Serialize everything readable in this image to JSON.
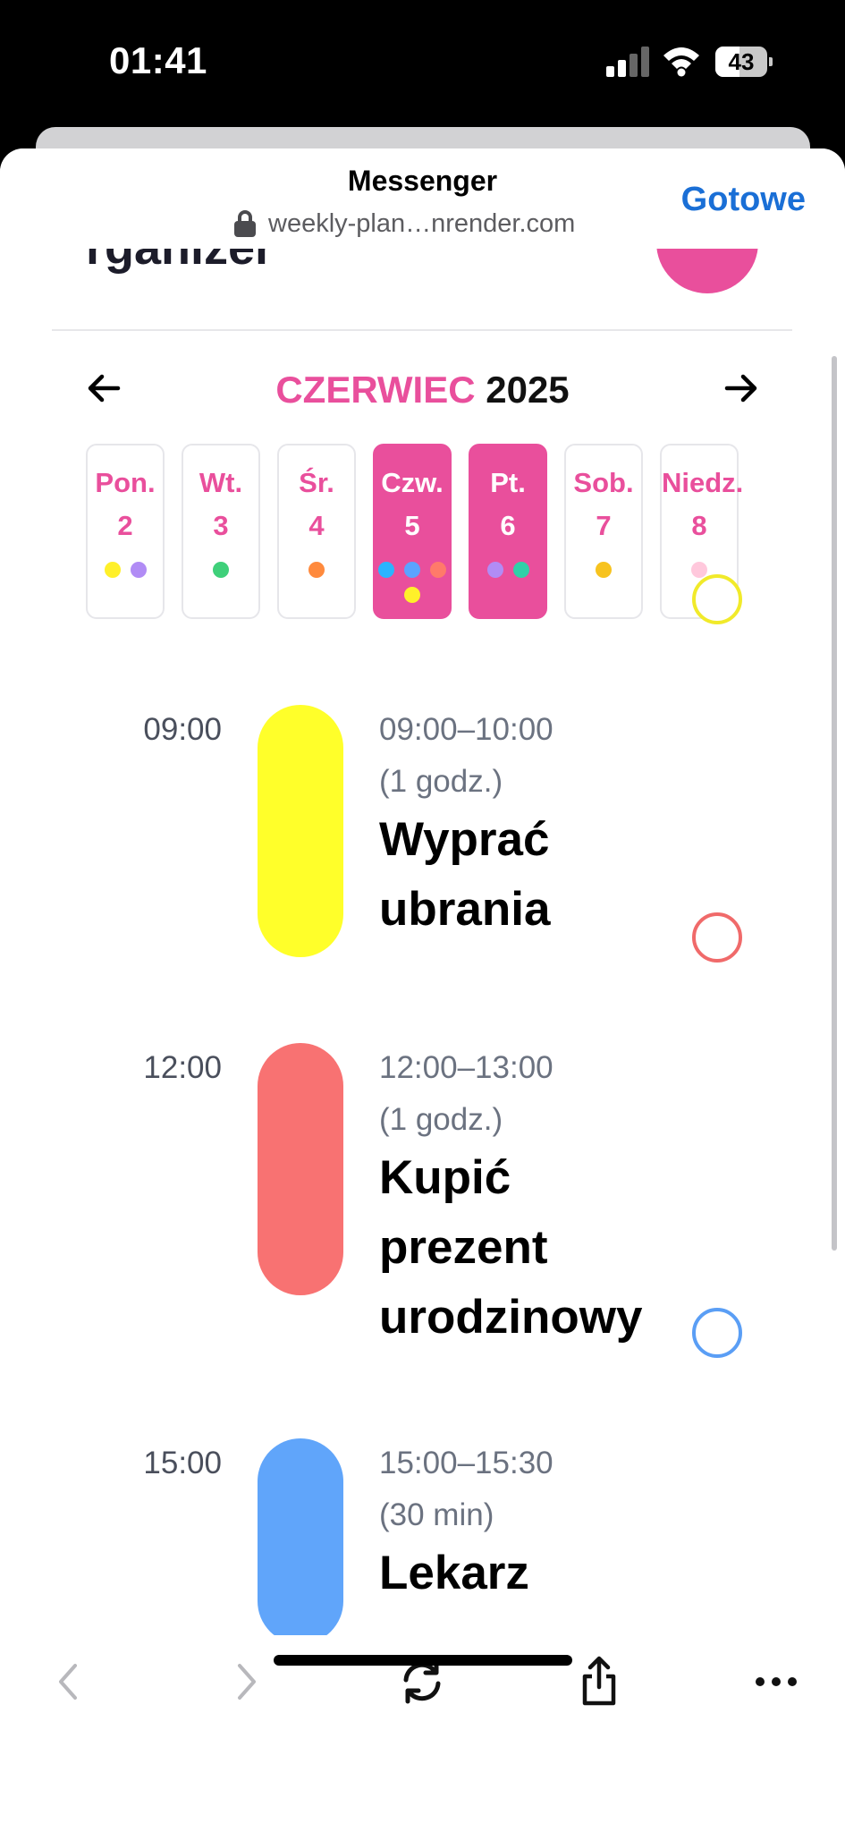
{
  "status_bar": {
    "time": "01:41",
    "battery": "43"
  },
  "browser": {
    "title": "Messenger",
    "url": "weekly-plan…nrender.com",
    "done_label": "Gotowe"
  },
  "page": {
    "partial_title": "rganizer"
  },
  "calendar": {
    "month": "CZERWIEC",
    "year": "2025",
    "days": [
      {
        "name": "Pon.",
        "num": "2",
        "active": false,
        "dots": [
          "#fff02a",
          "#b18cf5"
        ]
      },
      {
        "name": "Wt.",
        "num": "3",
        "active": false,
        "dots": [
          "#3fd07a"
        ]
      },
      {
        "name": "Śr.",
        "num": "4",
        "active": false,
        "dots": [
          "#ff8a3d"
        ]
      },
      {
        "name": "Czw.",
        "num": "5",
        "active": true,
        "dots": [
          "#2bb4ff",
          "#5ba3ff",
          "#ff7a6a",
          "#fff02a"
        ]
      },
      {
        "name": "Pt.",
        "num": "6",
        "active": true,
        "dots": [
          "#b18cf5",
          "#2fd0a8"
        ]
      },
      {
        "name": "Sob.",
        "num": "7",
        "active": false,
        "dots": [
          "#f7c31f"
        ]
      },
      {
        "name": "Niedz.",
        "num": "8",
        "active": false,
        "dots": [
          "#ffc8dc"
        ]
      }
    ]
  },
  "events": [
    {
      "time": "09:00",
      "range": "09:00–10:00",
      "duration": "(1 godz.)",
      "title_lines": [
        "Wyprać",
        "ubrania"
      ],
      "color": "#ffff2a",
      "check_color": "#f1ea2a"
    },
    {
      "time": "12:00",
      "range": "12:00–13:00",
      "duration": "(1 godz.)",
      "title_lines": [
        "Kupić",
        "prezent",
        "urodzinowy"
      ],
      "color": "#f87272",
      "check_color": "#f06a6a"
    },
    {
      "time": "15:00",
      "range": "15:00–15:30",
      "duration": "(30 min)",
      "title_lines": [
        "Lekarz"
      ],
      "color": "#60a5fa",
      "check_color": "#5a9ef5"
    }
  ],
  "toolbar": {
    "icons": [
      "back-icon",
      "forward-icon",
      "reload-icon",
      "share-icon",
      "more-icon"
    ]
  }
}
